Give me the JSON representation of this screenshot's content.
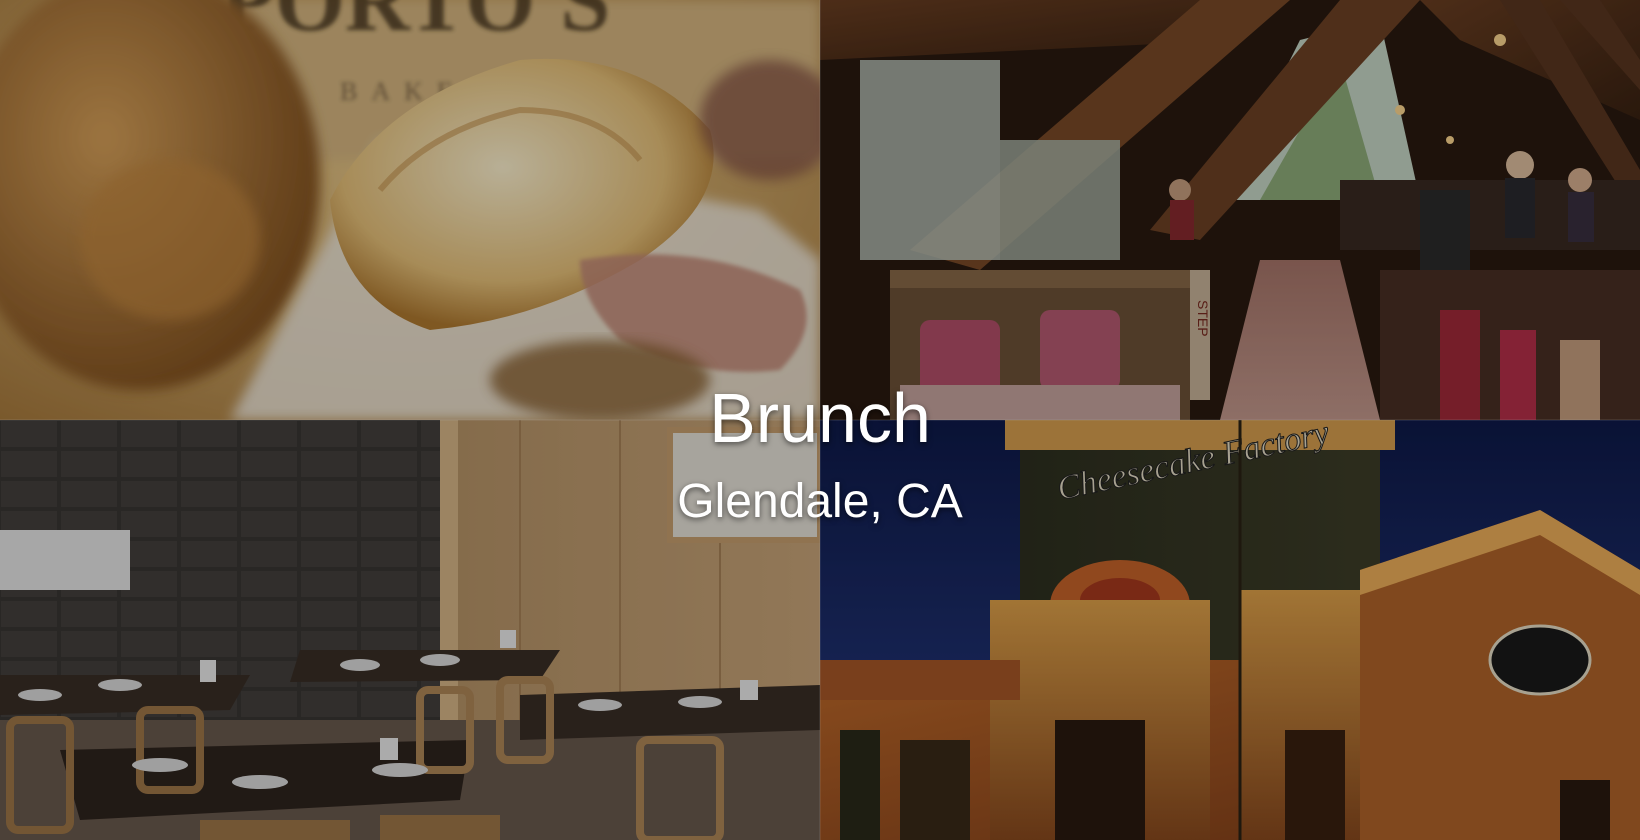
{
  "hero": {
    "title": "Brunch",
    "subtitle": "Glendale, CA"
  },
  "photos": [
    {
      "subject": "pastry-closeup",
      "sign_text": "PORTO'S",
      "sign_subtext": "BAKERY"
    },
    {
      "subject": "a-frame-restaurant-interior",
      "sign_text": "STEP"
    },
    {
      "subject": "dining-room-tables"
    },
    {
      "subject": "restaurant-exterior-night",
      "sign_text": "Cheesecake Factory"
    }
  ],
  "colors": {
    "overlay": "#000000",
    "text": "#ffffff"
  }
}
